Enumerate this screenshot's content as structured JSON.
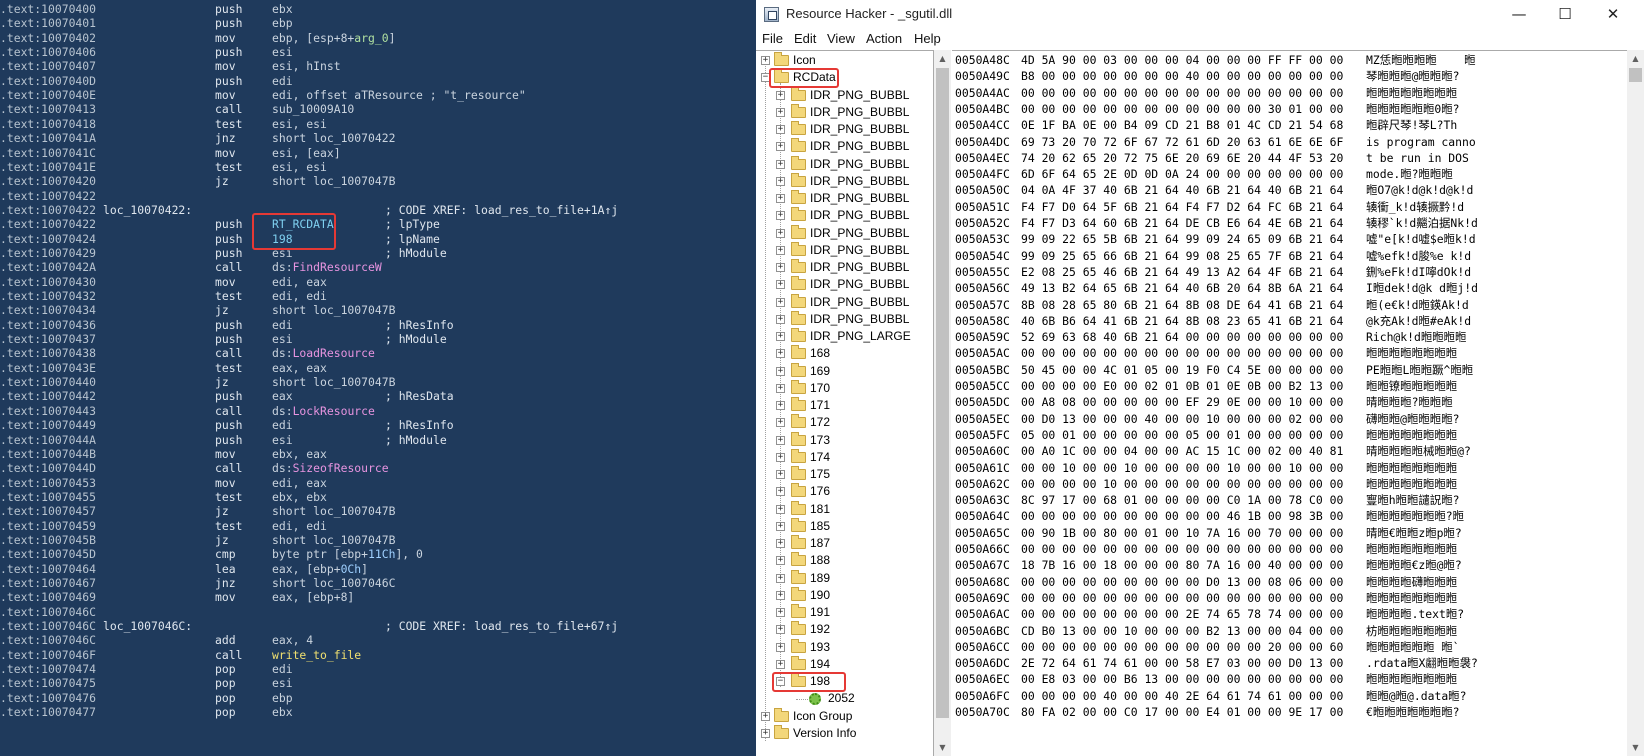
{
  "ida": {
    "lines": [
      {
        "addr": ".text:10070400",
        "label": "",
        "mnem": "push",
        "op": "ebx",
        "cmt": ""
      },
      {
        "addr": ".text:10070401",
        "label": "",
        "mnem": "push",
        "op": "ebp",
        "cmt": ""
      },
      {
        "addr": ".text:10070402",
        "label": "",
        "mnem": "mov",
        "op": "ebp, [esp+8+arg_0]",
        "cmt": ""
      },
      {
        "addr": ".text:10070406",
        "label": "",
        "mnem": "push",
        "op": "esi",
        "cmt": ""
      },
      {
        "addr": ".text:10070407",
        "label": "",
        "mnem": "mov",
        "op": "esi, hInst",
        "cmt": ""
      },
      {
        "addr": ".text:1007040D",
        "label": "",
        "mnem": "push",
        "op": "edi",
        "cmt": ""
      },
      {
        "addr": ".text:1007040E",
        "label": "",
        "mnem": "mov",
        "op": "edi, offset aTResource ; \"t_resource\"",
        "cmt": ""
      },
      {
        "addr": ".text:10070413",
        "label": "",
        "mnem": "call",
        "op": "sub_10009A10",
        "cmt": ""
      },
      {
        "addr": ".text:10070418",
        "label": "",
        "mnem": "test",
        "op": "esi, esi",
        "cmt": ""
      },
      {
        "addr": ".text:1007041A",
        "label": "",
        "mnem": "jnz",
        "op": "short loc_10070422",
        "cmt": ""
      },
      {
        "addr": ".text:1007041C",
        "label": "",
        "mnem": "mov",
        "op": "esi, [eax]",
        "cmt": ""
      },
      {
        "addr": ".text:1007041E",
        "label": "",
        "mnem": "test",
        "op": "esi, esi",
        "cmt": ""
      },
      {
        "addr": ".text:10070420",
        "label": "",
        "mnem": "jz",
        "op": "short loc_1007047B",
        "cmt": ""
      },
      {
        "addr": ".text:10070422",
        "label": "",
        "mnem": "",
        "op": "",
        "cmt": ""
      },
      {
        "addr": ".text:10070422",
        "label": "loc_10070422:",
        "mnem": "",
        "op": "",
        "cmt": "; CODE XREF: load_res_to_file+1A↑j"
      },
      {
        "addr": ".text:10070422",
        "label": "",
        "mnem": "push",
        "op": "RT_RCDATA",
        "cmt": "; lpType"
      },
      {
        "addr": ".text:10070424",
        "label": "",
        "mnem": "push",
        "op": "198",
        "cmt": "; lpName"
      },
      {
        "addr": ".text:10070429",
        "label": "",
        "mnem": "push",
        "op": "esi",
        "cmt": "; hModule"
      },
      {
        "addr": ".text:1007042A",
        "label": "",
        "mnem": "call",
        "op": "ds:FindResourceW",
        "cmt": ""
      },
      {
        "addr": ".text:10070430",
        "label": "",
        "mnem": "mov",
        "op": "edi, eax",
        "cmt": ""
      },
      {
        "addr": ".text:10070432",
        "label": "",
        "mnem": "test",
        "op": "edi, edi",
        "cmt": ""
      },
      {
        "addr": ".text:10070434",
        "label": "",
        "mnem": "jz",
        "op": "short loc_1007047B",
        "cmt": ""
      },
      {
        "addr": ".text:10070436",
        "label": "",
        "mnem": "push",
        "op": "edi",
        "cmt": "; hResInfo"
      },
      {
        "addr": ".text:10070437",
        "label": "",
        "mnem": "push",
        "op": "esi",
        "cmt": "; hModule"
      },
      {
        "addr": ".text:10070438",
        "label": "",
        "mnem": "call",
        "op": "ds:LoadResource",
        "cmt": ""
      },
      {
        "addr": ".text:1007043E",
        "label": "",
        "mnem": "test",
        "op": "eax, eax",
        "cmt": ""
      },
      {
        "addr": ".text:10070440",
        "label": "",
        "mnem": "jz",
        "op": "short loc_1007047B",
        "cmt": ""
      },
      {
        "addr": ".text:10070442",
        "label": "",
        "mnem": "push",
        "op": "eax",
        "cmt": "; hResData"
      },
      {
        "addr": ".text:10070443",
        "label": "",
        "mnem": "call",
        "op": "ds:LockResource",
        "cmt": ""
      },
      {
        "addr": ".text:10070449",
        "label": "",
        "mnem": "push",
        "op": "edi",
        "cmt": "; hResInfo"
      },
      {
        "addr": ".text:1007044A",
        "label": "",
        "mnem": "push",
        "op": "esi",
        "cmt": "; hModule"
      },
      {
        "addr": ".text:1007044B",
        "label": "",
        "mnem": "mov",
        "op": "ebx, eax",
        "cmt": ""
      },
      {
        "addr": ".text:1007044D",
        "label": "",
        "mnem": "call",
        "op": "ds:SizeofResource",
        "cmt": ""
      },
      {
        "addr": ".text:10070453",
        "label": "",
        "mnem": "mov",
        "op": "edi, eax",
        "cmt": ""
      },
      {
        "addr": ".text:10070455",
        "label": "",
        "mnem": "test",
        "op": "ebx, ebx",
        "cmt": ""
      },
      {
        "addr": ".text:10070457",
        "label": "",
        "mnem": "jz",
        "op": "short loc_1007047B",
        "cmt": ""
      },
      {
        "addr": ".text:10070459",
        "label": "",
        "mnem": "test",
        "op": "edi, edi",
        "cmt": ""
      },
      {
        "addr": ".text:1007045B",
        "label": "",
        "mnem": "jz",
        "op": "short loc_1007047B",
        "cmt": ""
      },
      {
        "addr": ".text:1007045D",
        "label": "",
        "mnem": "cmp",
        "op": "byte ptr [ebp+11Ch], 0",
        "cmt": ""
      },
      {
        "addr": ".text:10070464",
        "label": "",
        "mnem": "lea",
        "op": "eax, [ebp+0Ch]",
        "cmt": ""
      },
      {
        "addr": ".text:10070467",
        "label": "",
        "mnem": "jnz",
        "op": "short loc_1007046C",
        "cmt": ""
      },
      {
        "addr": ".text:10070469",
        "label": "",
        "mnem": "mov",
        "op": "eax, [ebp+8]",
        "cmt": ""
      },
      {
        "addr": ".text:1007046C",
        "label": "",
        "mnem": "",
        "op": "",
        "cmt": ""
      },
      {
        "addr": ".text:1007046C",
        "label": "loc_1007046C:",
        "mnem": "",
        "op": "",
        "cmt": "; CODE XREF: load_res_to_file+67↑j"
      },
      {
        "addr": ".text:1007046C",
        "label": "",
        "mnem": "add",
        "op": "eax, 4",
        "cmt": ""
      },
      {
        "addr": ".text:1007046F",
        "label": "",
        "mnem": "call",
        "op": "write_to_file",
        "cmt": ""
      },
      {
        "addr": ".text:10070474",
        "label": "",
        "mnem": "pop",
        "op": "edi",
        "cmt": ""
      },
      {
        "addr": ".text:10070475",
        "label": "",
        "mnem": "pop",
        "op": "esi",
        "cmt": ""
      },
      {
        "addr": ".text:10070476",
        "label": "",
        "mnem": "pop",
        "op": "ebp",
        "cmt": ""
      },
      {
        "addr": ".text:10070477",
        "label": "",
        "mnem": "pop",
        "op": "ebx",
        "cmt": ""
      }
    ]
  },
  "rh": {
    "title": "Resource Hacker  -  _sgutil.dll",
    "buttons": {
      "minimize": "—",
      "maximize": "☐",
      "close": "✕"
    },
    "menu": [
      "File",
      "Edit",
      "View",
      "Action",
      "Help"
    ],
    "tree": {
      "top": [
        {
          "label": "Icon",
          "expander": "+"
        },
        {
          "label": "RCData",
          "expander": "−"
        }
      ],
      "children": [
        "IDR_PNG_BUBBL",
        "IDR_PNG_BUBBL",
        "IDR_PNG_BUBBL",
        "IDR_PNG_BUBBL",
        "IDR_PNG_BUBBL",
        "IDR_PNG_BUBBL",
        "IDR_PNG_BUBBL",
        "IDR_PNG_BUBBL",
        "IDR_PNG_BUBBL",
        "IDR_PNG_BUBBL",
        "IDR_PNG_BUBBL",
        "IDR_PNG_BUBBL",
        "IDR_PNG_BUBBL",
        "IDR_PNG_BUBBL",
        "IDR_PNG_LARGE",
        "168",
        "169",
        "170",
        "171",
        "172",
        "173",
        "174",
        "175",
        "176",
        "181",
        "185",
        "187",
        "188",
        "189",
        "190",
        "191",
        "192",
        "193",
        "194",
        "198"
      ],
      "selected_child": "198",
      "leaf": "2052",
      "bottom": [
        "Icon Group",
        "Version Info"
      ]
    },
    "hex_rows": [
      {
        "off": "0050A48C",
        "bytes": "4D 5A 90 00 03 00 00 00 04 00 00 00 FF FF 00 00",
        "ascii": "MZ恁暅暅暅暅    暅"
      },
      {
        "off": "0050A49C",
        "bytes": "B8 00 00 00 00 00 00 00 40 00 00 00 00 00 00 00",
        "ascii": "琴暅暅暅@暅暅暅?"
      },
      {
        "off": "0050A4AC",
        "bytes": "00 00 00 00 00 00 00 00 00 00 00 00 00 00 00 00",
        "ascii": "暅暅暅暅暅暅暅暅"
      },
      {
        "off": "0050A4BC",
        "bytes": "00 00 00 00 00 00 00 00 00 00 00 00 30 01 00 00",
        "ascii": "暅暅暅暅暅暅0暅?"
      },
      {
        "off": "0050A4CC",
        "bytes": "0E 1F BA 0E 00 B4 09 CD 21 B8 01 4C CD 21 54 68",
        "ascii": "暅辟尺琴!琴L?Th"
      },
      {
        "off": "0050A4DC",
        "bytes": "69 73 20 70 72 6F 67 72 61 6D 20 63 61 6E 6E 6F",
        "ascii": "is program canno"
      },
      {
        "off": "0050A4EC",
        "bytes": "74 20 62 65 20 72 75 6E 20 69 6E 20 44 4F 53 20",
        "ascii": "t be run in DOS "
      },
      {
        "off": "0050A4FC",
        "bytes": "6D 6F 64 65 2E 0D 0D 0A 24 00 00 00 00 00 00 00",
        "ascii": "mode.暅?暅暅暅"
      },
      {
        "off": "0050A50C",
        "bytes": "04 0A 4F 37 40 6B 21 64 40 6B 21 64 40 6B 21 64",
        "ascii": "暅O7@k!d@k!d@k!d"
      },
      {
        "off": "0050A51C",
        "bytes": "F4 F7 D0 64 5F 6B 21 64 F4 F7 D2 64 FC 6B 21 64",
        "ascii": "辏衝_k!d辏撅黔!d"
      },
      {
        "off": "0050A52C",
        "bytes": "F4 F7 D3 64 60 6B 21 64 DE CB E6 64 4E 6B 21 64",
        "ascii": "辏穋`k!d齆泊据Nk!d"
      },
      {
        "off": "0050A53C",
        "bytes": "99 09 22 65 5B 6B 21 64 99 09 24 65 09 6B 21 64",
        "ascii": "嘘\"e[k!d嘘$e暅k!d"
      },
      {
        "off": "0050A54C",
        "bytes": "99 09 25 65 66 6B 21 64 99 08 25 65 7F 6B 21 64",
        "ascii": "嘘%efk!d朘%e k!d"
      },
      {
        "off": "0050A55C",
        "bytes": "E2 08 25 65 46 6B 21 64 49 13 A2 64 4F 6B 21 64",
        "ascii": "鉶%eFk!dI嚀dOk!d"
      },
      {
        "off": "0050A56C",
        "bytes": "49 13 B2 64 65 6B 21 64 40 6B 20 64 8B 6A 21 64",
        "ascii": "I暅dek!d@k d暅j!d"
      },
      {
        "off": "0050A57C",
        "bytes": "8B 08 28 65 80 6B 21 64 8B 08 DE 64 41 6B 21 64",
        "ascii": "暅(e€k!d暅鍈Ak!d"
      },
      {
        "off": "0050A58C",
        "bytes": "40 6B B6 64 41 6B 21 64 8B 08 23 65 41 6B 21 64",
        "ascii": "@k充Ak!d暅#eAk!d"
      },
      {
        "off": "0050A59C",
        "bytes": "52 69 63 68 40 6B 21 64 00 00 00 00 00 00 00 00",
        "ascii": "Rich@k!d暅暅暅暅"
      },
      {
        "off": "0050A5AC",
        "bytes": "00 00 00 00 00 00 00 00 00 00 00 00 00 00 00 00",
        "ascii": "暅暅暅暅暅暅暅暅"
      },
      {
        "off": "0050A5BC",
        "bytes": "50 45 00 00 4C 01 05 00 19 F0 C4 5E 00 00 00 00",
        "ascii": "PE暅暅L暅暅蹶^暅暅"
      },
      {
        "off": "0050A5CC",
        "bytes": "00 00 00 00 E0 00 02 01 0B 01 0E 0B 00 B2 13 00",
        "ascii": "暅暅镣暅暅暅暅暅"
      },
      {
        "off": "0050A5DC",
        "bytes": "00 A8 08 00 00 00 00 00 EF 29 0E 00 00 10 00 00",
        "ascii": "晴暅暅暅?暅暅暅"
      },
      {
        "off": "0050A5EC",
        "bytes": "00 D0 13 00 00 00 40 00 00 10 00 00 00 02 00 00",
        "ascii": "礴暅暅@暅暅暅暅?"
      },
      {
        "off": "0050A5FC",
        "bytes": "05 00 01 00 00 00 00 00 05 00 01 00 00 00 00 00",
        "ascii": "暅暅暅暅暅暅暅暅"
      },
      {
        "off": "0050A60C",
        "bytes": "00 A0 1C 00 00 04 00 00 AC 15 1C 00 02 00 40 81",
        "ascii": "晴暅暅暅暅械暅暅@?"
      },
      {
        "off": "0050A61C",
        "bytes": "00 00 10 00 00 10 00 00 00 00 10 00 00 10 00 00",
        "ascii": "暅暅暅暅暅暅暅暅"
      },
      {
        "off": "0050A62C",
        "bytes": "00 00 00 00 10 00 00 00 00 00 00 00 00 00 00 00",
        "ascii": "暅暅暅暅暅暅暅暅"
      },
      {
        "off": "0050A63C",
        "bytes": "8C 97 17 00 68 01 00 00 00 00 C0 1A 00 78 C0 00",
        "ascii": "寷暅h暅暅譴詋暅?"
      },
      {
        "off": "0050A64C",
        "bytes": "00 00 00 00 00 00 00 00 00 00 46 1B 00 98 3B 00",
        "ascii": "暅暅暅暅暅暅暅?暅"
      },
      {
        "off": "0050A65C",
        "bytes": "00 90 1B 00 80 00 01 00 10 7A 16 00 70 00 00 00",
        "ascii": "晴暅€暅暅z暅p暅?"
      },
      {
        "off": "0050A66C",
        "bytes": "00 00 00 00 00 00 00 00 00 00 00 00 00 00 00 00",
        "ascii": "暅暅暅暅暅暅暅暅"
      },
      {
        "off": "0050A67C",
        "bytes": "18 7B 16 00 18 00 00 00 80 7A 16 00 40 00 00 00",
        "ascii": "暅暅暅暅€z暅@暅?"
      },
      {
        "off": "0050A68C",
        "bytes": "00 00 00 00 00 00 00 00 00 D0 13 00 08 06 00 00",
        "ascii": "暅暅暅暅礴暅暅暅"
      },
      {
        "off": "0050A69C",
        "bytes": "00 00 00 00 00 00 00 00 00 00 00 00 00 00 00 00",
        "ascii": "暅暅暅暅暅暅暅暅"
      },
      {
        "off": "0050A6AC",
        "bytes": "00 00 00 00 00 00 00 00 2E 74 65 78 74 00 00 00",
        "ascii": "暅暅暅暅.text暅?"
      },
      {
        "off": "0050A6BC",
        "bytes": "CD B0 13 00 00 10 00 00 00 B2 13 00 00 04 00 00",
        "ascii": "枋暅暅暅暅暅暅暅"
      },
      {
        "off": "0050A6CC",
        "bytes": "00 00 00 00 00 00 00 00 00 00 00 00 20 00 00 60",
        "ascii": "暅暅暅暅暅暅 暅`"
      },
      {
        "off": "0050A6DC",
        "bytes": "2E 72 64 61 74 61 00 00 58 E7 03 00 00 D0 13 00",
        "ascii": ".rdata暅X翽暅暅袰?"
      },
      {
        "off": "0050A6EC",
        "bytes": "00 E8 03 00 00 B6 13 00 00 00 00 00 00 00 00 00",
        "ascii": "暅暅暅暅暅暅暅暅"
      },
      {
        "off": "0050A6FC",
        "bytes": "00 00 00 00 40 00 00 40 2E 64 61 74 61 00 00 00",
        "ascii": "暅暅@暅@.data暅?"
      },
      {
        "off": "0050A70C",
        "bytes": "80 FA 02 00 00 C0 17 00 00 E4 01 00 00 9E 17 00",
        "ascii": "€暅暅暅暅暅暅暅?"
      }
    ]
  }
}
